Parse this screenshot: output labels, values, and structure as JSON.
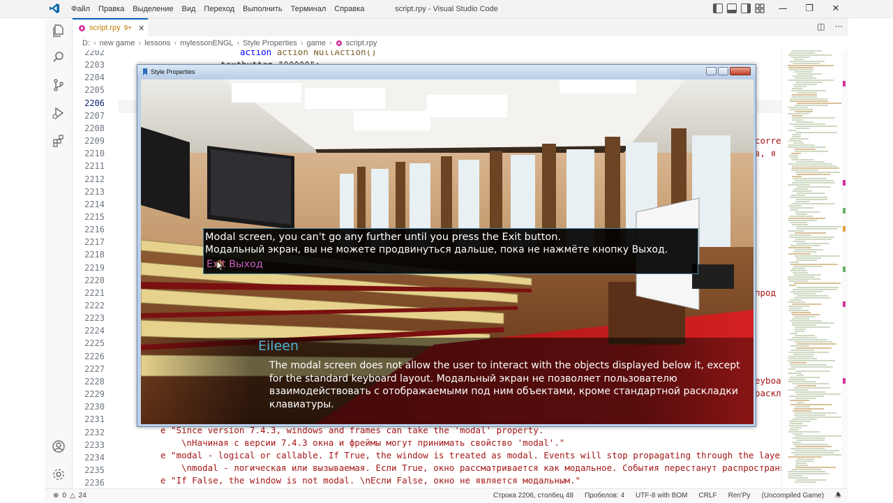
{
  "window": {
    "title": "script.rpy - Visual Studio Code",
    "menu": [
      "Файл",
      "Правка",
      "Выделение",
      "Вид",
      "Переход",
      "Выполнить",
      "Терминал",
      "Справка"
    ]
  },
  "tab": {
    "label": "script.rpy",
    "count": "9+"
  },
  "breadcrumb": [
    "D:",
    "new game",
    "lessons",
    "mylessonENGL",
    "Style Properties",
    "game",
    "script.rpy"
  ],
  "editor": {
    "active_line": "2206",
    "line_numbers": [
      "2202",
      "2203",
      "2204",
      "2205",
      "2206",
      "2207",
      "2208",
      "2209",
      "2210",
      "2211",
      "2212",
      "2213",
      "2214",
      "2215",
      "2216",
      "2217",
      "2218",
      "2219",
      "2220",
      "2221",
      "2222",
      "2223",
      "2224",
      "2225",
      "2226",
      "2227",
      "2228",
      "2229",
      "2230",
      "2231",
      "2232",
      "2233",
      "2234",
      "2235",
      "2236"
    ],
    "visible_code": {
      "l2202": "action NullAction()",
      "l2203": "textbutton \"^^^^^\":",
      "l2232": "e \"Since version 7.4.3, windows and frames can take the 'modal' property.",
      "l2233": "\\nНачиная с версии 7.4.3 окна и фреймы могут принимать свойство 'modal'.\"",
      "l2234": "e \"modal - logical or callable. If True, the window is treated as modal. Events will stop propagating through the layers as",
      "l2235": "\\nmodal - логическая или вызываемая. Если True, окно рассматривается как модальное. События перестанут распространяться",
      "l2236": "e \"If False, the window is not modal. \\nЕсли False, окно не является модальным.\"",
      "right_fragments": [
        "corre",
        "в, я п",
        "прод",
        "eyboa",
        "раскл"
      ]
    }
  },
  "statusbar": {
    "errors": "0",
    "warnings": "24",
    "position": "Строка 2206, столбец 48",
    "spaces": "Пробелов: 4",
    "encoding": "UTF-8 with BOM",
    "eol": "CRLF",
    "language": "Ren'Py",
    "mode": "(Uncompiled Game)"
  },
  "renpy": {
    "title": "Style Properties",
    "modal": {
      "line1": "Modal screen, you can't go any further until you press the Exit button.",
      "line2": "Модальный экран, вы не можете продвинуться дальше, пока не нажмёте кнопку Выход.",
      "button": "Exit Выход"
    },
    "speaker": "Eileen",
    "dialogue": "The modal screen does not allow the user to interact with the objects displayed below it, except for the standard keyboard layout. Модальный экран не позволяет пользователю взаимодействовать с отображаемыми под ним объектами, кроме стандартной раскладки клавиатуры."
  },
  "colors": {
    "accent": "#005fb8",
    "speaker": "#4fb0d0",
    "modal_button": "#c85fc0",
    "modal_border": "#4d8fa6"
  },
  "icons": [
    "vscode-logo-icon",
    "explorer-icon",
    "search-icon",
    "source-control-icon",
    "run-debug-icon",
    "extensions-icon",
    "account-icon",
    "settings-gear-icon",
    "renpy-file-icon",
    "close-icon",
    "split-editor-icon",
    "more-actions-icon",
    "error-icon",
    "warning-icon",
    "bell-icon"
  ]
}
